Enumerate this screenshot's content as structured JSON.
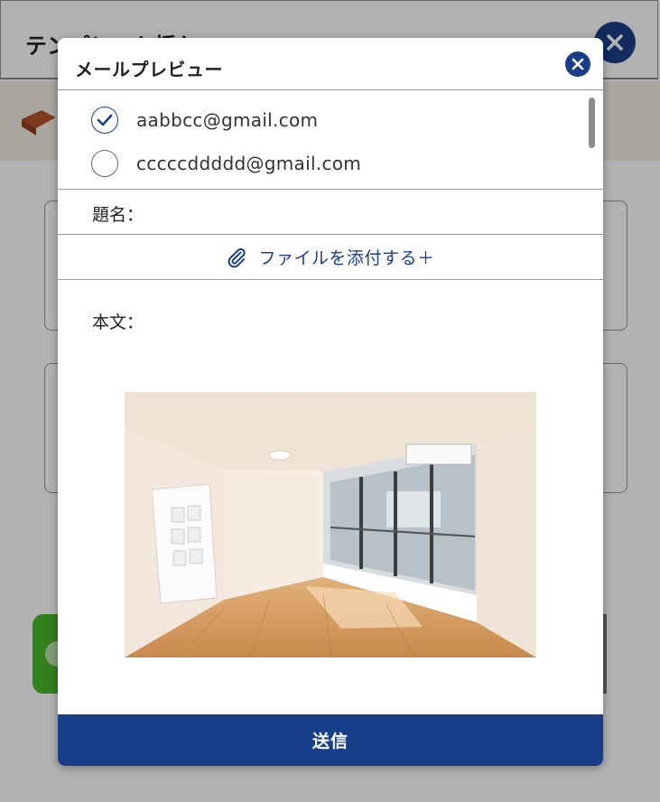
{
  "background": {
    "page_title": "テンプレート挿入"
  },
  "modal": {
    "title": "メールプレビュー",
    "recipients": [
      {
        "email": "aabbcc@gmail.com",
        "selected": true
      },
      {
        "email": "cccccddddd@gmail.com",
        "selected": false
      }
    ],
    "subject_label": "題名：",
    "attach_label": "ファイルを添付する＋",
    "body_label": "本文：",
    "send_label": "送信"
  },
  "colors": {
    "accent": "#1a3f8a",
    "border": "#9a9a9a"
  },
  "icons": {
    "close": "close-icon",
    "checkmark": "checkmark-icon",
    "attach": "paperclip-icon"
  }
}
